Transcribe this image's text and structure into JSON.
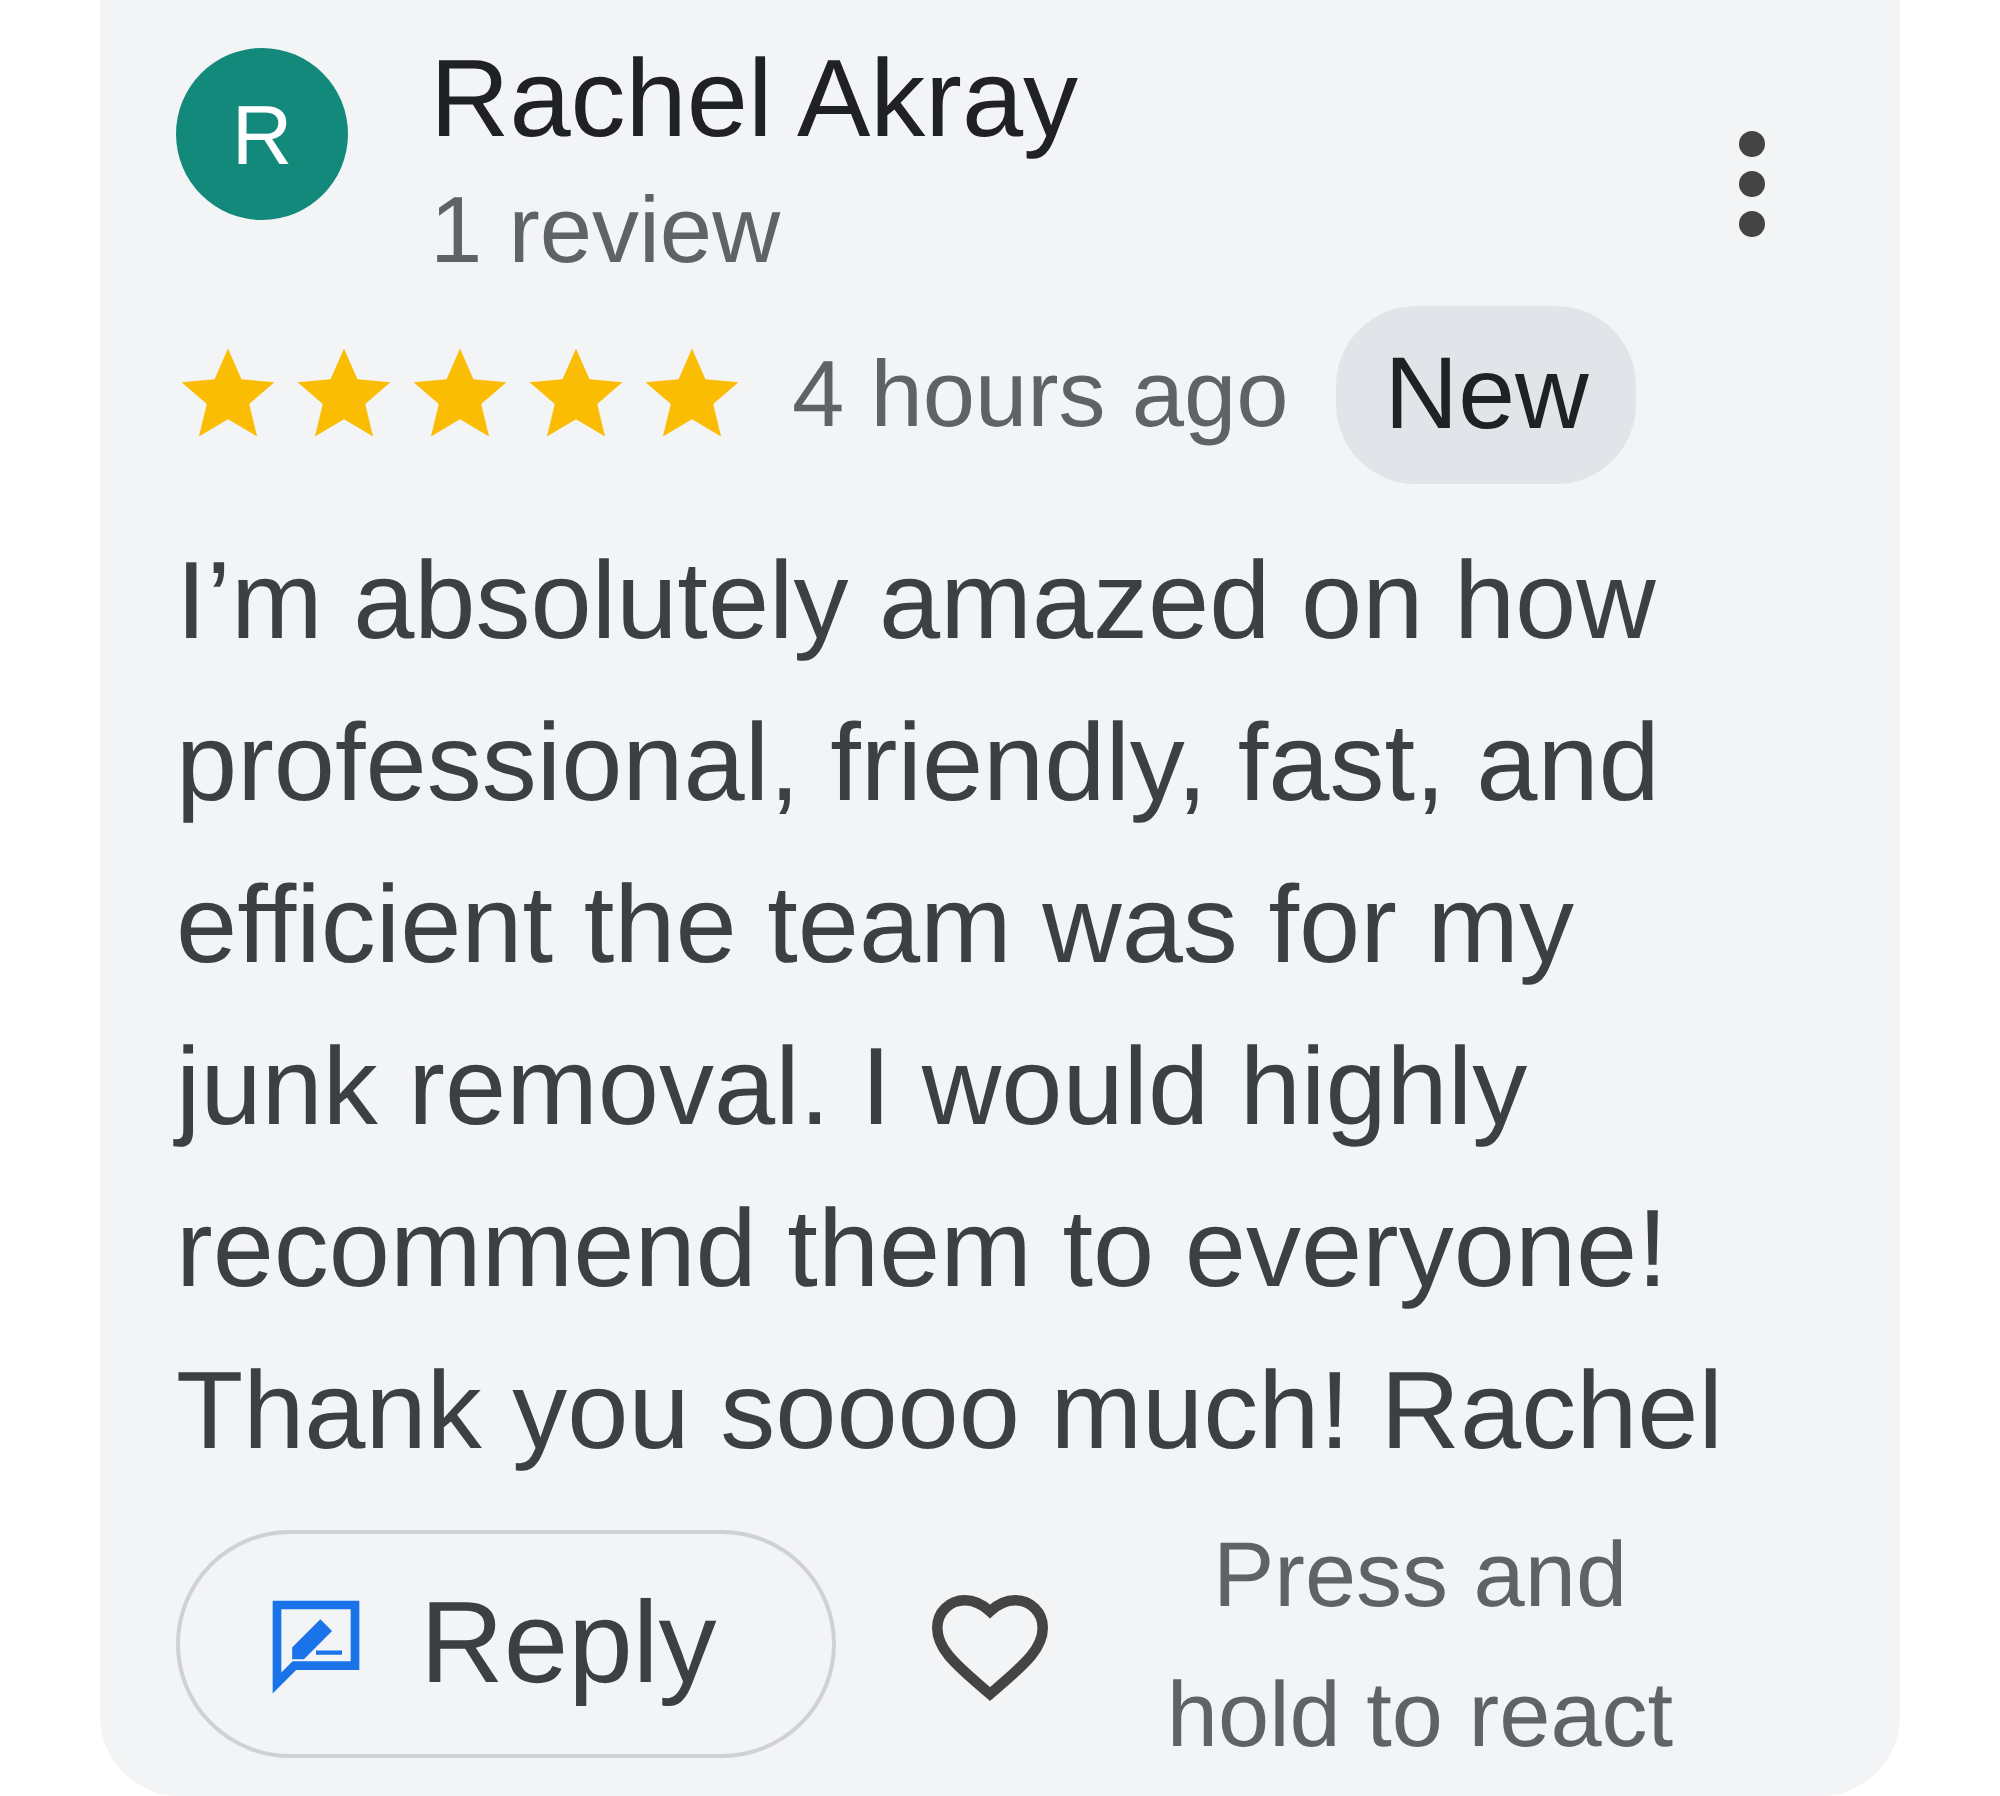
{
  "review": {
    "avatar_letter": "R",
    "author": "Rachel Akray",
    "author_meta": "1 review",
    "stars": 5,
    "time": "4 hours ago",
    "badge": "New",
    "text": "I’m absolutely amazed on how professional, friendly, fast, and efficient the team was for my junk removal. I would highly recommend them to everyone! Thank you soooo much! Rachel"
  },
  "actions": {
    "reply_label": "Reply",
    "react_hint": "Press and hold to react"
  }
}
